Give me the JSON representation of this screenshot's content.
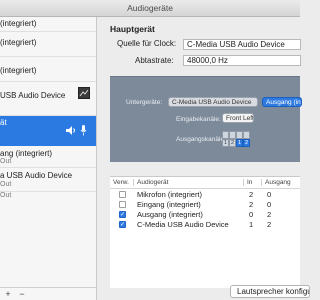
{
  "window": {
    "title": "Audiogeräte"
  },
  "sidebar": {
    "devices": [
      {
        "name": "(integriert)"
      },
      {
        "name": "(integriert)"
      },
      {
        "name": "(integriert)"
      },
      {
        "name": "USB Audio Device"
      },
      {
        "name": "ät"
      },
      {
        "name": "ang (integriert)",
        "sub": "Out"
      },
      {
        "name": "a USB Audio Device",
        "sub": "Out"
      },
      {
        "name": "",
        "sub": "Out"
      }
    ],
    "footer": {
      "add": "+",
      "remove": "−"
    }
  },
  "main": {
    "heading": "Hauptgerät",
    "clock_label": "Quelle für Clock:",
    "clock_value": "C-Media USB Audio Device",
    "rate_label": "Abtastrate:",
    "rate_value": "48000,0 Hz",
    "subdevices_label": "Untergeräte:",
    "subdevice_1": "C-Media USB Audio Device",
    "subdevice_2": "Ausgang (integriert)",
    "input_channels_label": "Eingabekanäle:",
    "input_channels_value": "Front Left",
    "output_channels_label": "Ausgangskanäle:",
    "output_channels": [
      "1",
      "2",
      "1",
      "2"
    ]
  },
  "table": {
    "headers": {
      "use": "Verw.",
      "device": "Audiogerät",
      "in": "In",
      "out": "Ausgang"
    },
    "rows": [
      {
        "checked": false,
        "name": "Mikrofon (integriert)",
        "in": "2",
        "out": "0"
      },
      {
        "checked": false,
        "name": "Eingang (integriert)",
        "in": "2",
        "out": "0"
      },
      {
        "checked": true,
        "name": "Ausgang (integriert)",
        "in": "0",
        "out": "2"
      },
      {
        "checked": true,
        "name": "C-Media USB Audio Device",
        "in": "1",
        "out": "2"
      }
    ]
  },
  "bottom_button": "Lautsprecher konfigurieren",
  "colors": {
    "accent": "#2a7ae2",
    "panel": "#7d8a9a"
  }
}
